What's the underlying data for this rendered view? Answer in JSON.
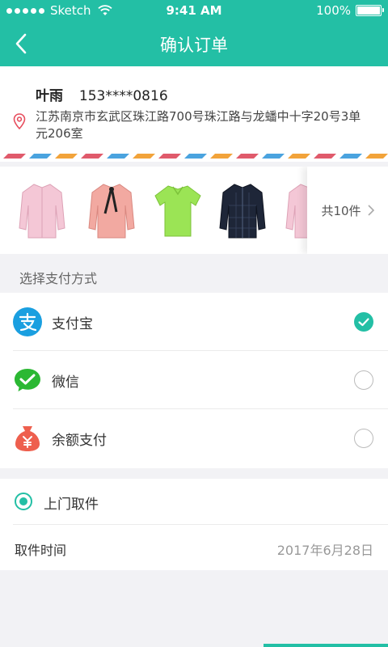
{
  "status_bar": {
    "carrier": "Sketch",
    "time": "9:41 AM",
    "battery": "100%"
  },
  "nav": {
    "title": "确认订单",
    "back_icon": "chevron-left-icon"
  },
  "address": {
    "name": "叶雨",
    "phone": "153****0816",
    "full_address": "江苏南京市玄武区珠江路700号珠江路与龙蟠中十字20号3单元206室",
    "icon": "location-pin-icon",
    "stripe_colors": [
      "#e05a6b",
      "#4aa3df",
      "#f2a33a"
    ]
  },
  "products": {
    "items": [
      {
        "name": "pink-shirt",
        "color": "#f4c7d6"
      },
      {
        "name": "pink-bow-blouse",
        "color": "#f2a9a1"
      },
      {
        "name": "green-polo",
        "color": "#9be455"
      },
      {
        "name": "navy-plaid-shirt",
        "color": "#1e2638"
      },
      {
        "name": "pink-shirt-2",
        "color": "#f4c7d6"
      }
    ],
    "more_label": "共10件"
  },
  "payment": {
    "section_title": "选择支付方式",
    "options": [
      {
        "label": "支付宝",
        "icon": "alipay-icon",
        "color": "#1a9fe0",
        "selected": true
      },
      {
        "label": "微信",
        "icon": "wechat-icon",
        "color": "#2bb833",
        "selected": false
      },
      {
        "label": "余额支付",
        "icon": "moneybag-icon",
        "color": "#ee5f4e",
        "selected": false
      }
    ]
  },
  "pickup": {
    "label": "上门取件",
    "time_label": "取件时间",
    "time_value": "2017年6月28日"
  },
  "accent_color": "#23bfa5"
}
